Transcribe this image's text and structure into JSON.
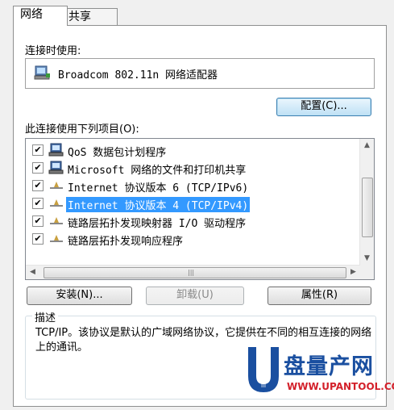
{
  "tabs": [
    {
      "label": "网络",
      "active": true
    },
    {
      "label": "共享",
      "active": false
    }
  ],
  "connect_using_label": "连接时使用:",
  "adapter": {
    "name": "Broadcom 802.11n 网络适配器",
    "icon": "network-adapter-icon"
  },
  "configure_button": "配置(C)...",
  "items_label": "此连接使用下列项目(O):",
  "items": [
    {
      "label": "QoS 数据包计划程序",
      "checked": true,
      "icon": "network-service-icon",
      "selected": false
    },
    {
      "label": "Microsoft 网络的文件和打印机共享",
      "checked": true,
      "icon": "network-service-icon",
      "selected": false
    },
    {
      "label": "Internet 协议版本 6 (TCP/IPv6)",
      "checked": true,
      "icon": "protocol-icon",
      "selected": false
    },
    {
      "label": "Internet 协议版本 4 (TCP/IPv4)",
      "checked": true,
      "icon": "protocol-icon",
      "selected": true
    },
    {
      "label": "链路层拓扑发现映射器 I/O 驱动程序",
      "checked": true,
      "icon": "protocol-icon",
      "selected": false
    },
    {
      "label": "链路层拓扑发现响应程序",
      "checked": true,
      "icon": "protocol-icon",
      "selected": false
    }
  ],
  "buttons": {
    "install": "安装(N)...",
    "uninstall": "卸载(U)",
    "properties": "属性(R)"
  },
  "description": {
    "title": "描述",
    "text": "TCP/IP。该协议是默认的广域网络协议，它提供在不同的相互连接的网络上的通讯。"
  },
  "watermark": {
    "brand": "盘量产网",
    "url": "WWW.UPANTOOL.COM"
  },
  "colors": {
    "selection": "#3399ff",
    "watermark_blue": "#1a4fa0",
    "watermark_red": "#d3202a"
  }
}
